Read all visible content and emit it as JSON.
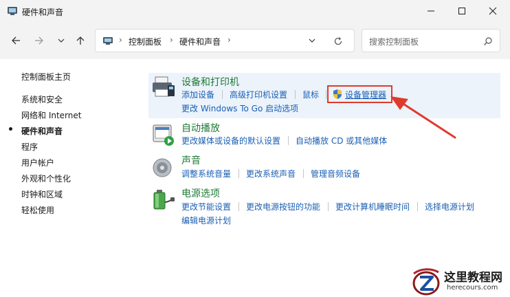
{
  "window": {
    "title": "硬件和声音"
  },
  "address": {
    "crumbs": [
      "控制面板",
      "硬件和声音"
    ]
  },
  "search": {
    "placeholder": "搜索控制面板"
  },
  "sidebar": {
    "items": [
      {
        "label": "控制面板主页"
      },
      {
        "label": "系统和安全"
      },
      {
        "label": "网络和 Internet"
      },
      {
        "label": "硬件和声音",
        "active": true
      },
      {
        "label": "程序"
      },
      {
        "label": "用户帐户"
      },
      {
        "label": "外观和个性化"
      },
      {
        "label": "时钟和区域"
      },
      {
        "label": "轻松使用"
      }
    ]
  },
  "categories": [
    {
      "title": "设备和打印机",
      "icon": "printer-icon",
      "links": [
        "添加设备",
        "高级打印机设置",
        "鼠标",
        "设备管理器",
        "更改 Windows To Go 启动选项"
      ]
    },
    {
      "title": "自动播放",
      "icon": "autoplay-icon",
      "links": [
        "更改媒体或设备的默认设置",
        "自动播放 CD 或其他媒体"
      ]
    },
    {
      "title": "声音",
      "icon": "speaker-icon",
      "links": [
        "调整系统音量",
        "更改系统声音",
        "管理音频设备"
      ]
    },
    {
      "title": "电源选项",
      "icon": "battery-icon",
      "links": [
        "更改节能设置",
        "更改电源按钮的功能",
        "更改计算机睡眠时间",
        "选择电源计划",
        "编辑电源计划"
      ]
    }
  ],
  "highlight": {
    "color": "#e03a2e",
    "target": "设备管理器"
  },
  "watermark": {
    "title": "这里教程网",
    "url": "herecours.com"
  },
  "colors": {
    "link": "#1a5fb4",
    "category_title": "#1f7a36",
    "chrome": "#f3f3f3",
    "highlight_bg": "#ecf3fb"
  }
}
